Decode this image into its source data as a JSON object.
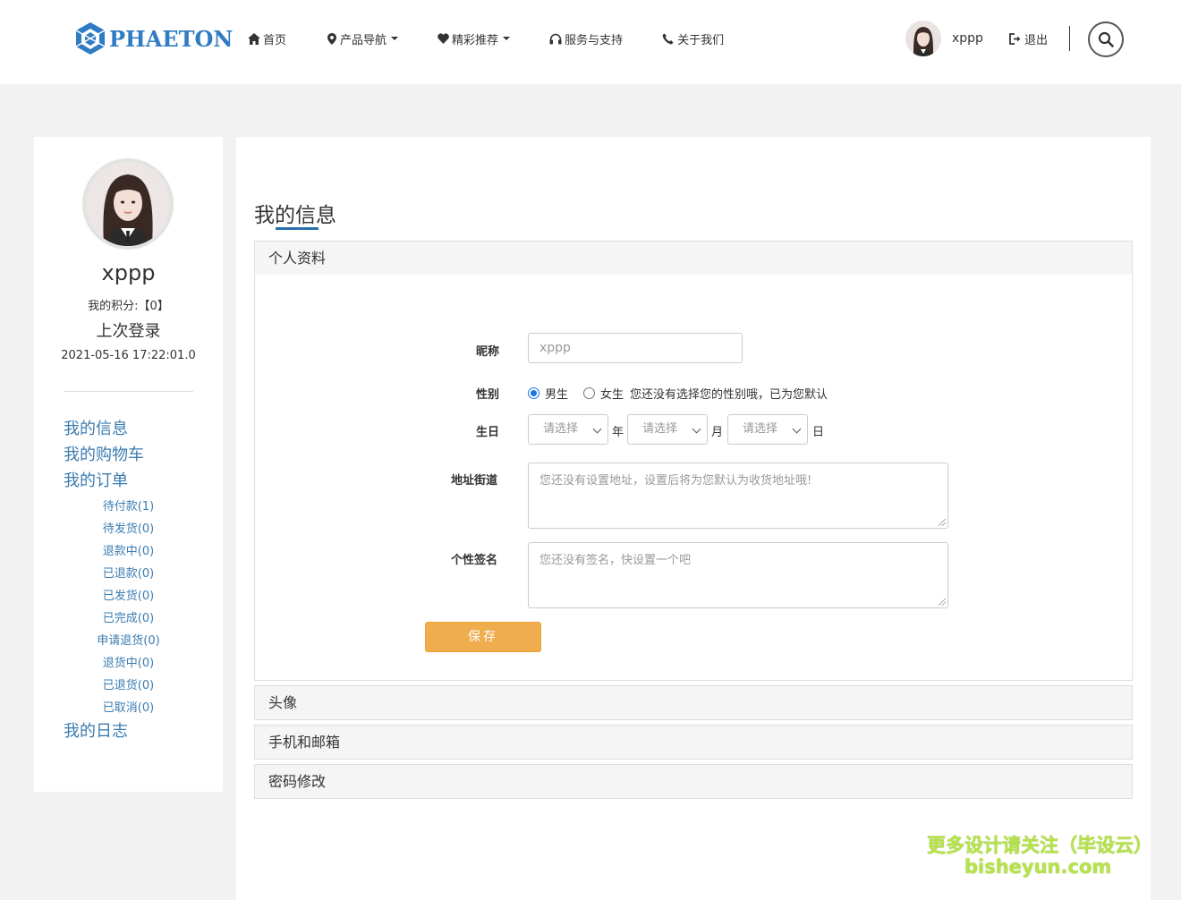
{
  "header": {
    "logo_text": "PHAETON",
    "nav": [
      {
        "icon": "home-icon",
        "label": "首页",
        "dropdown": false
      },
      {
        "icon": "map-marker-icon",
        "label": "产品导航",
        "dropdown": true
      },
      {
        "icon": "heart-icon",
        "label": "精彩推荐",
        "dropdown": true
      },
      {
        "icon": "headphones-icon",
        "label": "服务与支持",
        "dropdown": false
      },
      {
        "icon": "phone-icon",
        "label": "关于我们",
        "dropdown": false
      }
    ],
    "username": "xppp",
    "logout_label": "退出"
  },
  "sidebar": {
    "name": "xppp",
    "points": "我的积分:【0】",
    "last_login_label": "上次登录",
    "last_login_time": "2021-05-16 17:22:01.0",
    "links": {
      "info": "我的信息",
      "cart": "我的购物车",
      "orders": "我的订单",
      "log": "我的日志"
    },
    "order_items": [
      "待付款(1)",
      "待发货(0)",
      "退款中(0)",
      "已退款(0)",
      "已发货(0)",
      "已完成(0)",
      "申请退货(0)",
      "退货中(0)",
      "已退货(0)",
      "已取消(0)"
    ]
  },
  "main": {
    "title": "我的信息",
    "panels": {
      "profile": "个人资料",
      "avatar": "头像",
      "contact": "手机和邮箱",
      "password": "密码修改"
    },
    "form": {
      "nickname_label": "昵称",
      "nickname_value": "xppp",
      "gender_label": "性别",
      "gender_male": "男生",
      "gender_female": "女生",
      "gender_note": "您还没有选择您的性别哦，已为您默认",
      "gender_selected": "male",
      "birthday_label": "生日",
      "select_placeholder": "请选择",
      "year_unit": "年",
      "month_unit": "月",
      "day_unit": "日",
      "address_label": "地址街道",
      "address_placeholder": "您还没有设置地址，设置后将为您默认为收货地址哦!",
      "signature_label": "个性签名",
      "signature_placeholder": "您还没有签名，快设置一个吧",
      "save_label": "保存"
    }
  },
  "watermark": {
    "line1": "更多设计请关注（毕设云）",
    "line2": "bisheyun.com"
  },
  "colors": {
    "brand": "#2f7bc4",
    "link": "#3b7cb0",
    "save": "#f0ad4e",
    "watermark": "#b7e34a"
  }
}
